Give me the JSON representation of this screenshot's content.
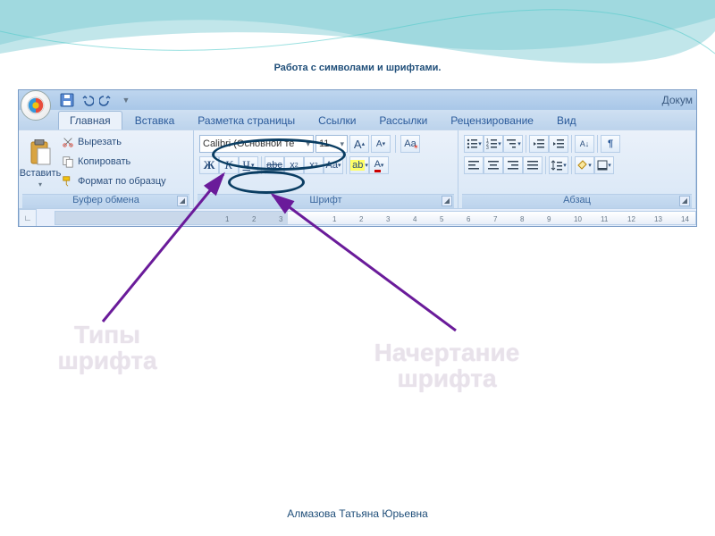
{
  "slide_title": "Работа с символами и шрифтами.",
  "author": "Алмазова Татьяна Юрьевна",
  "doc_title": "Докум",
  "tabs": {
    "home": "Главная",
    "insert": "Вставка",
    "layout": "Разметка страницы",
    "refs": "Ссылки",
    "mail": "Рассылки",
    "review": "Рецензирование",
    "view": "Вид"
  },
  "clipboard": {
    "paste": "Вставить",
    "cut": "Вырезать",
    "copy": "Копировать",
    "format_painter": "Формат по образцу",
    "label": "Буфер обмена"
  },
  "font": {
    "family_value": "Calibri (Основной те",
    "size_value": "11",
    "bold": "Ж",
    "italic": "К",
    "underline": "Ч",
    "strike": "abc",
    "case": "Aa",
    "highlight": "ab",
    "font_color": "A",
    "grow": "A",
    "shrink": "A",
    "clear": "Aa",
    "sub": "x₂",
    "sup": "x²",
    "label": "Шрифт"
  },
  "paragraph": {
    "label": "Абзац"
  },
  "annotations": {
    "font_types": "Типы\nшрифта",
    "font_style": "Начертание\nшрифта"
  },
  "colors": {
    "accent": "#1f4e79",
    "ellipse": "#0a3d62",
    "arrow": "#6a1b9a"
  }
}
